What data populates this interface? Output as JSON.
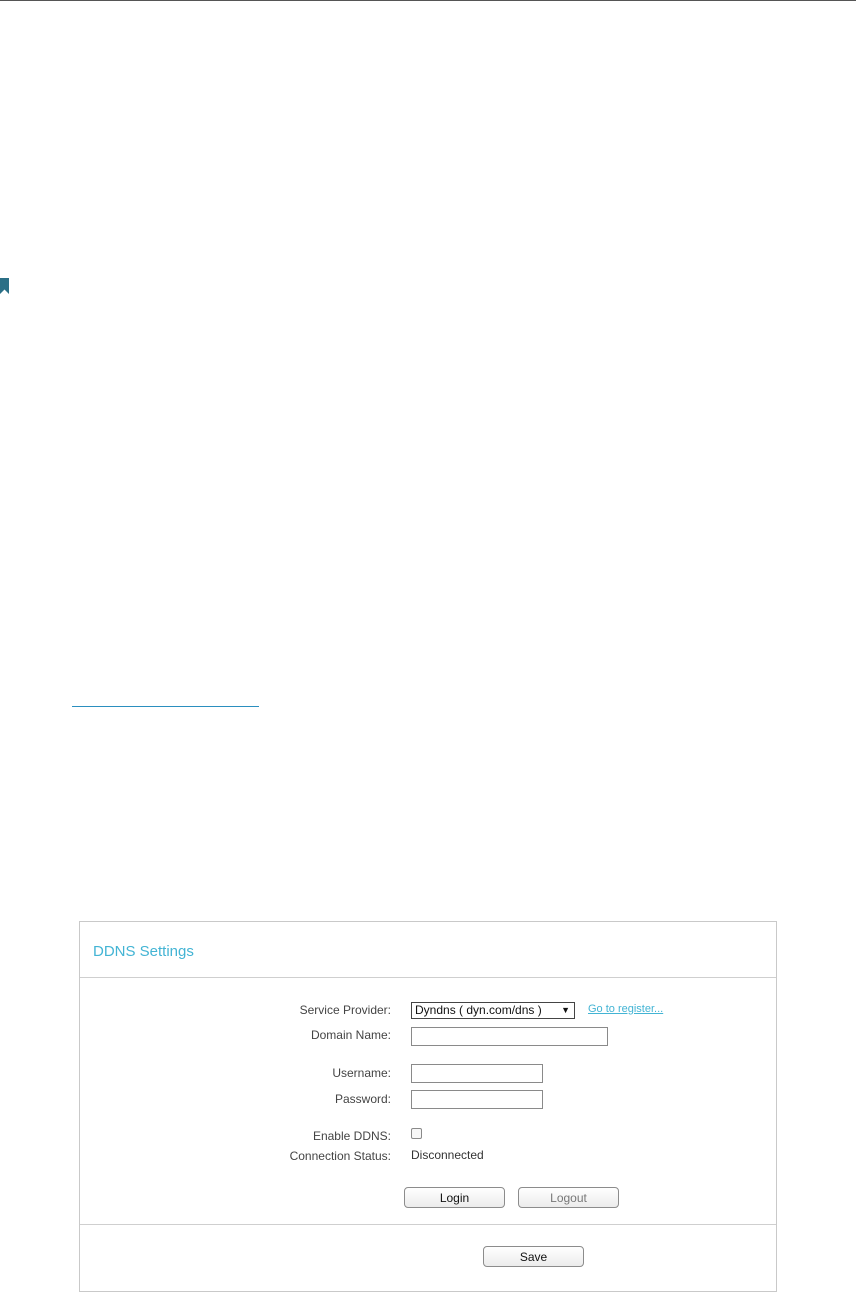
{
  "panel": {
    "title": "DDNS Settings",
    "labels": {
      "service_provider": "Service Provider:",
      "domain_name": "Domain Name:",
      "username": "Username:",
      "password": "Password:",
      "enable_ddns": "Enable DDNS:",
      "connection_status": "Connection Status:"
    },
    "service_provider_value": "Dyndns ( dyn.com/dns )",
    "register_link": "Go to register...",
    "domain_name_value": "",
    "username_value": "",
    "password_value": "",
    "enable_ddns_checked": false,
    "connection_status_value": "Disconnected",
    "login_label": "Login",
    "logout_label": "Logout",
    "save_label": "Save"
  },
  "colors": {
    "accent": "#43b4d4",
    "bookmark": "#2b6f86"
  },
  "icons": {
    "dropdown": "triangle-down-icon",
    "bookmark": "bookmark-icon"
  }
}
